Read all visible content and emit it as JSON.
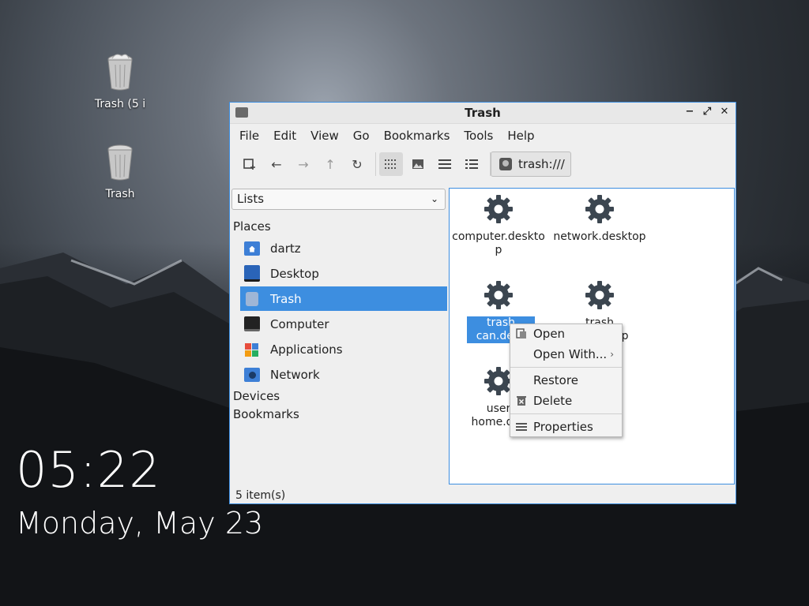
{
  "desktop": {
    "icons": [
      {
        "label": "Trash (5 i"
      },
      {
        "label": "Trash"
      }
    ],
    "clock": {
      "time": "05:22",
      "date": "Monday, May 23"
    }
  },
  "window": {
    "title": "Trash",
    "menu": [
      "File",
      "Edit",
      "View",
      "Go",
      "Bookmarks",
      "Tools",
      "Help"
    ],
    "address": "trash:///",
    "sidebar": {
      "selector": "Lists",
      "places_heading": "Places",
      "places": [
        {
          "label": "dartz",
          "icon": "home-folder-icon"
        },
        {
          "label": "Desktop",
          "icon": "desktop-icon"
        },
        {
          "label": "Trash",
          "icon": "trash-icon",
          "selected": true
        },
        {
          "label": "Computer",
          "icon": "computer-icon"
        },
        {
          "label": "Applications",
          "icon": "applications-icon"
        },
        {
          "label": "Network",
          "icon": "network-folder-icon"
        }
      ],
      "devices_heading": "Devices",
      "bookmarks_heading": "Bookmarks"
    },
    "files": [
      {
        "line1": "computer.deskto",
        "line2": "p"
      },
      {
        "line1": "network.desktop",
        "line2": ""
      },
      {
        "line1": "trash",
        "line2": "can.desk"
      },
      {
        "line1": "trash",
        "line2": "top"
      },
      {
        "line1": "user",
        "line2": "home.des"
      }
    ],
    "status": "5 item(s)"
  },
  "context_menu": {
    "items": [
      "Open",
      "Open With...",
      "Restore",
      "Delete",
      "Properties"
    ]
  },
  "colors": {
    "accent": "#3d8ee0"
  }
}
